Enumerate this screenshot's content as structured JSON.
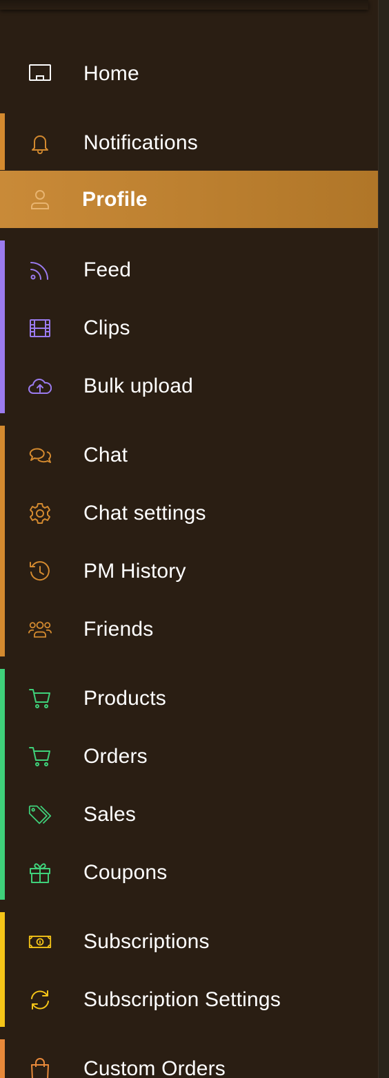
{
  "colors": {
    "orange": "#d48a2f",
    "purple": "#9b7bef",
    "green": "#3fd17a",
    "yellow": "#f5c518",
    "active_bg": "#c98a38"
  },
  "nav": {
    "home": {
      "label": "Home",
      "icon": "monitor-icon"
    },
    "notifications": {
      "label": "Notifications",
      "icon": "bell-icon"
    },
    "profile": {
      "label": "Profile",
      "icon": "user-icon",
      "active": true
    },
    "feed": {
      "label": "Feed",
      "icon": "rss-icon"
    },
    "clips": {
      "label": "Clips",
      "icon": "film-icon"
    },
    "bulk_upload": {
      "label": "Bulk upload",
      "icon": "cloud-upload-icon"
    },
    "chat": {
      "label": "Chat",
      "icon": "chat-bubbles-icon"
    },
    "chat_settings": {
      "label": "Chat settings",
      "icon": "gear-icon"
    },
    "pm_history": {
      "label": "PM History",
      "icon": "history-icon"
    },
    "friends": {
      "label": "Friends",
      "icon": "users-icon"
    },
    "products": {
      "label": "Products",
      "icon": "cart-icon"
    },
    "orders": {
      "label": "Orders",
      "icon": "cart-icon"
    },
    "sales": {
      "label": "Sales",
      "icon": "tag-icon"
    },
    "coupons": {
      "label": "Coupons",
      "icon": "gift-icon"
    },
    "subscriptions": {
      "label": "Subscriptions",
      "icon": "banknote-icon"
    },
    "subscription_settings": {
      "label": "Subscription Settings",
      "icon": "refresh-icon"
    },
    "custom_orders": {
      "label": "Custom Orders",
      "icon": "shopping-bag-icon"
    }
  }
}
